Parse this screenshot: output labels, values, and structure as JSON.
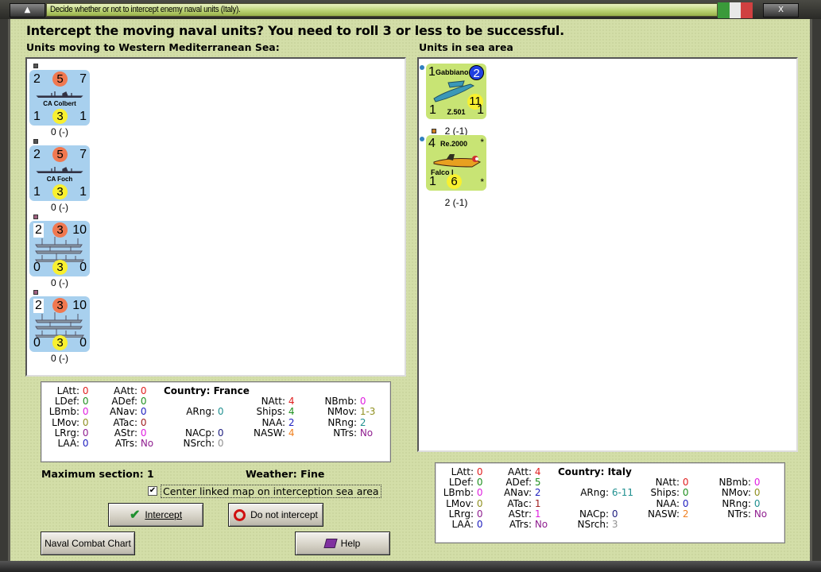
{
  "window": {
    "title": "Decide whether or not to intercept enemy naval units (Italy).",
    "flag_colors": [
      "#3a9a3a",
      "#e8e8e8",
      "#d04040"
    ]
  },
  "heading": "Intercept the moving naval units?  You need to roll 3 or less to be successful.",
  "left_panel": {
    "title": "Units moving to Western Mediterranean Sea:",
    "units": [
      {
        "tl": "2",
        "circle": "5",
        "tr": "7",
        "name": "CA Colbert",
        "bl": "1",
        "bc": "3",
        "br": "1",
        "below": "0 (-)",
        "type": "ship",
        "mark": "#555555"
      },
      {
        "tl": "2",
        "circle": "5",
        "tr": "7",
        "name": "CA Foch",
        "bl": "1",
        "bc": "3",
        "br": "1",
        "below": "0 (-)",
        "type": "ship",
        "mark": "#555555"
      },
      {
        "tl": "2",
        "circle": "3",
        "tr": "10",
        "name": "",
        "bl": "0",
        "bc": "3",
        "br": "0",
        "below": "0 (-)",
        "type": "transport",
        "mark": "#a06080"
      },
      {
        "tl": "2",
        "circle": "3",
        "tr": "10",
        "name": "",
        "bl": "0",
        "bc": "3",
        "br": "0",
        "below": "0 (-)",
        "type": "transport",
        "mark": "#a06080"
      }
    ]
  },
  "right_panel": {
    "title": "Units in sea area",
    "units": [
      {
        "tl": "1",
        "label": "Gabbiano",
        "badge": "2",
        "mid": "11",
        "bl": "1",
        "name": "Z.501",
        "br": "1",
        "below": "2 (-1)",
        "mark": "#3080c0"
      },
      {
        "tl": "4",
        "label": "Re.2000",
        "star": "*",
        "name": "Falco I",
        "bl": "1",
        "bc": "6",
        "br": "*",
        "below": "2 (-1)",
        "mark": "#3080c0",
        "top_mark": "#d08020"
      }
    ]
  },
  "france_stats": {
    "country": "Country: France",
    "rows": [
      [
        {
          "l": "LAtt:",
          "v": "0",
          "c": "#e02020"
        },
        {
          "l": "AAtt:",
          "v": "0",
          "c": "#e02020"
        },
        null,
        null,
        null
      ],
      [
        {
          "l": "LDef:",
          "v": "0",
          "c": "#209020"
        },
        {
          "l": "ADef:",
          "v": "0",
          "c": "#209020"
        },
        null,
        {
          "l": "NAtt:",
          "v": "4",
          "c": "#e02020"
        },
        {
          "l": "NBmb:",
          "v": "0",
          "c": "#e020e0"
        }
      ],
      [
        {
          "l": "LBmb:",
          "v": "0",
          "c": "#e020e0"
        },
        {
          "l": "ANav:",
          "v": "0",
          "c": "#2020c0"
        },
        {
          "l": "ARng:",
          "v": "0",
          "c": "#209090"
        },
        {
          "l": "Ships:",
          "v": "4",
          "c": "#209020"
        },
        {
          "l": "NMov:",
          "v": "1-3",
          "c": "#909020"
        }
      ],
      [
        {
          "l": "LMov:",
          "v": "0",
          "c": "#909020"
        },
        {
          "l": "ATac:",
          "v": "0",
          "c": "#a02020"
        },
        null,
        {
          "l": "NAA:",
          "v": "2",
          "c": "#2020c0"
        },
        {
          "l": "NRng:",
          "v": "2",
          "c": "#209090"
        }
      ],
      [
        {
          "l": "LRrg:",
          "v": "0",
          "c": "#902090"
        },
        {
          "l": "AStr:",
          "v": "0",
          "c": "#e020e0"
        },
        {
          "l": "NACp:",
          "v": "0",
          "c": "#202080"
        },
        {
          "l": "NASW:",
          "v": "4",
          "c": "#f08020"
        },
        {
          "l": "NTrs:",
          "v": "No",
          "c": "#902090"
        }
      ],
      [
        {
          "l": "LAA:",
          "v": "0",
          "c": "#2020c0"
        },
        {
          "l": "ATrs:",
          "v": "No",
          "c": "#902090"
        },
        {
          "l": "NSrch:",
          "v": "0",
          "c": "#909090"
        },
        null,
        null
      ]
    ]
  },
  "italy_stats": {
    "country": "Country: Italy",
    "rows": [
      [
        {
          "l": "LAtt:",
          "v": "0",
          "c": "#e02020"
        },
        {
          "l": "AAtt:",
          "v": "4",
          "c": "#e02020"
        },
        null,
        null,
        null
      ],
      [
        {
          "l": "LDef:",
          "v": "0",
          "c": "#209020"
        },
        {
          "l": "ADef:",
          "v": "5",
          "c": "#209020"
        },
        null,
        {
          "l": "NAtt:",
          "v": "0",
          "c": "#e02020"
        },
        {
          "l": "NBmb:",
          "v": "0",
          "c": "#e020e0"
        }
      ],
      [
        {
          "l": "LBmb:",
          "v": "0",
          "c": "#e020e0"
        },
        {
          "l": "ANav:",
          "v": "2",
          "c": "#2020c0"
        },
        {
          "l": "ARng:",
          "v": "6-11",
          "c": "#209090"
        },
        {
          "l": "Ships:",
          "v": "0",
          "c": "#209020"
        },
        {
          "l": "NMov:",
          "v": "0",
          "c": "#909020"
        }
      ],
      [
        {
          "l": "LMov:",
          "v": "0",
          "c": "#909020"
        },
        {
          "l": "ATac:",
          "v": "1",
          "c": "#a02020"
        },
        null,
        {
          "l": "NAA:",
          "v": "0",
          "c": "#2020c0"
        },
        {
          "l": "NRng:",
          "v": "0",
          "c": "#209090"
        }
      ],
      [
        {
          "l": "LRrg:",
          "v": "0",
          "c": "#902090"
        },
        {
          "l": "AStr:",
          "v": "1",
          "c": "#e020e0"
        },
        {
          "l": "NACp:",
          "v": "0",
          "c": "#202080"
        },
        {
          "l": "NASW:",
          "v": "2",
          "c": "#f08020"
        },
        {
          "l": "NTrs:",
          "v": "No",
          "c": "#902090"
        }
      ],
      [
        {
          "l": "LAA:",
          "v": "0",
          "c": "#2020c0"
        },
        {
          "l": "ATrs:",
          "v": "No",
          "c": "#902090"
        },
        {
          "l": "NSrch:",
          "v": "3",
          "c": "#909090"
        },
        null,
        null
      ]
    ]
  },
  "max_section": "Maximum section: 1",
  "weather": "Weather:  Fine",
  "center_checkbox": {
    "label": "Center linked map on interception sea area",
    "checked": true,
    "mark": "✔"
  },
  "buttons": {
    "intercept": "Intercept",
    "do_not_intercept": "Do not intercept",
    "naval_chart": "Naval Combat Chart",
    "help": "Help"
  }
}
